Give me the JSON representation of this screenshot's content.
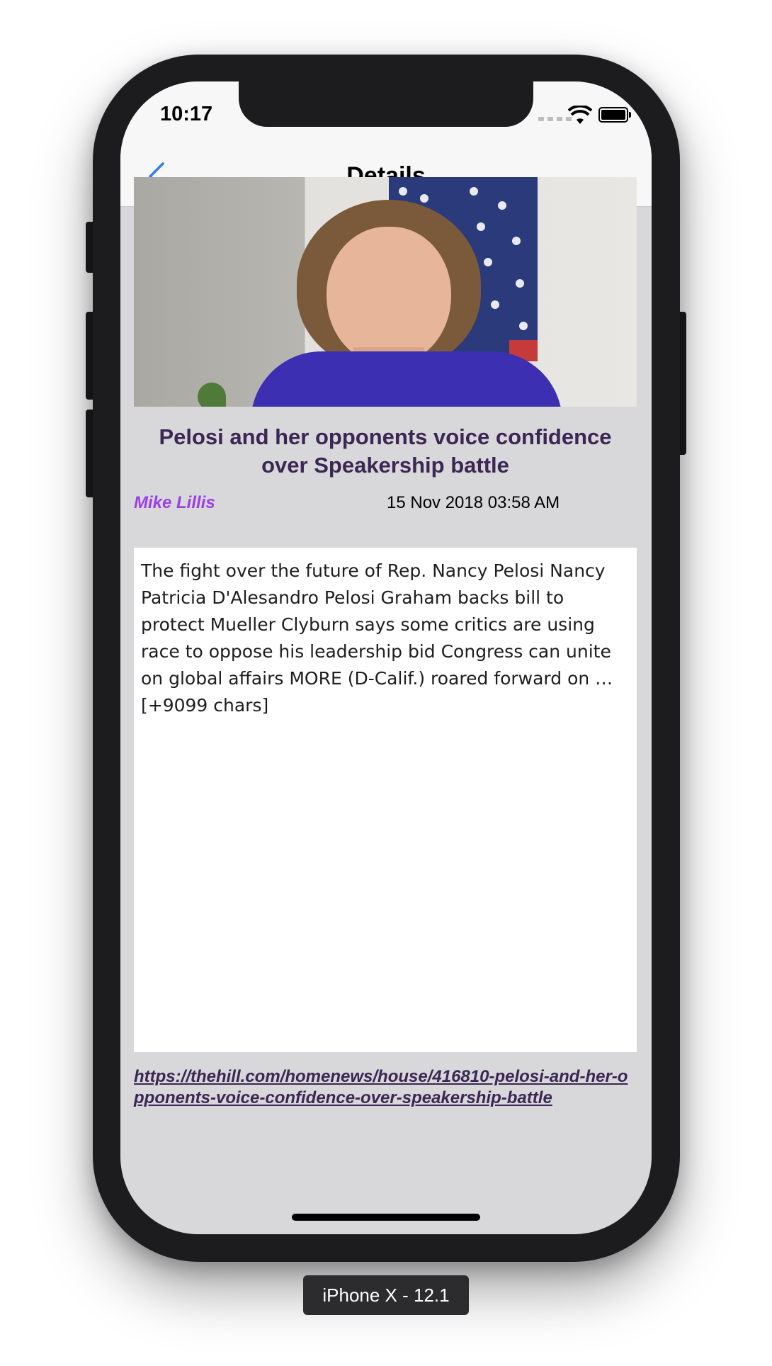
{
  "status_bar": {
    "time": "10:17"
  },
  "nav": {
    "title": "Details",
    "back_icon": "chevron-left-icon"
  },
  "article": {
    "title": "Pelosi and her opponents voice confidence over Speakership battle",
    "author": "Mike Lillis",
    "date": "15 Nov 2018 03:58 AM",
    "body": "The fight over the future of Rep. Nancy Pelosi Nancy Patricia D'Alesandro Pelosi Graham backs bill to protect Mueller Clyburn says some critics are using race to oppose his leadership bid Congress can unite on global affairs MORE (D-Calif.) roared forward on … [+9099 chars]",
    "url": "https://thehill.com/homenews/house/416810-pelosi-and-her-opponents-voice-confidence-over-speakership-battle"
  },
  "device_label": "iPhone X - 12.1",
  "colors": {
    "title": "#3b2654",
    "author": "#9b3fe6",
    "back": "#2f7cf6"
  }
}
